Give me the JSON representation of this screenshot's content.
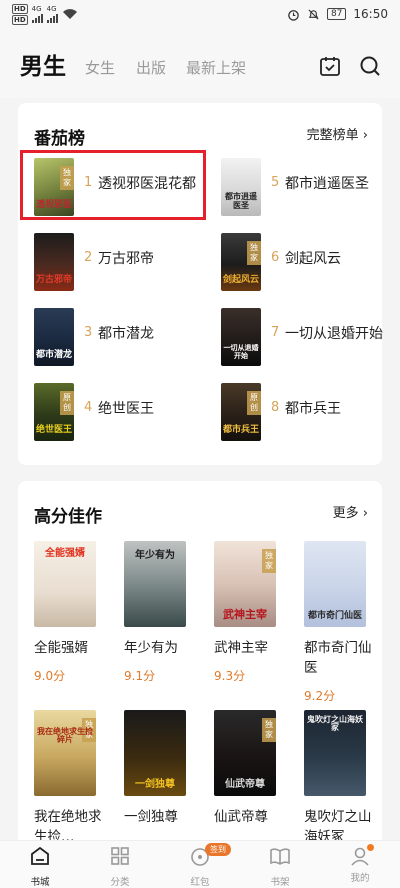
{
  "status_bar": {
    "sim1": "HD",
    "sim2": "HD",
    "network1": "4G",
    "network2": "4G",
    "battery": "87",
    "time": "16:50"
  },
  "header": {
    "tabs": [
      "男生",
      "女生",
      "出版",
      "最新上架"
    ],
    "active_tab": "男生"
  },
  "ranking": {
    "title": "番茄榜",
    "more_label": "完整榜单",
    "items": [
      {
        "rank": "1",
        "title": "透视邪医混花都",
        "cover_text": "透视邪医",
        "badge": "独家"
      },
      {
        "rank": "5",
        "title": "都市逍遥医圣",
        "cover_text": "都市逍遥医圣",
        "badge": ""
      },
      {
        "rank": "2",
        "title": "万古邪帝",
        "cover_text": "万古邪帝",
        "badge": ""
      },
      {
        "rank": "6",
        "title": "剑起风云",
        "cover_text": "剑起风云",
        "badge": "独家"
      },
      {
        "rank": "3",
        "title": "都市潜龙",
        "cover_text": "都市潜龙",
        "badge": ""
      },
      {
        "rank": "7",
        "title": "一切从退婚开始",
        "cover_text": "一切从退婚开始",
        "badge": ""
      },
      {
        "rank": "4",
        "title": "绝世医王",
        "cover_text": "绝世医王",
        "badge": "原创"
      },
      {
        "rank": "8",
        "title": "都市兵王",
        "cover_text": "都市兵王",
        "badge": "原创"
      }
    ]
  },
  "high_score": {
    "title": "高分佳作",
    "more_label": "更多",
    "items": [
      {
        "title": "全能强婿",
        "score": "9.0分",
        "cover_text": "全能强婿",
        "badge": ""
      },
      {
        "title": "年少有为",
        "score": "9.1分",
        "cover_text": "年少有为",
        "badge": ""
      },
      {
        "title": "武神主宰",
        "score": "9.3分",
        "cover_text": "武神主宰",
        "badge": "独家"
      },
      {
        "title": "都市奇门仙医",
        "score": "9.2分",
        "cover_text": "都市奇门仙医",
        "badge": ""
      },
      {
        "title": "我在绝地求生捡…",
        "score": "",
        "cover_text": "我在绝地求生捡碎片",
        "badge": "独家"
      },
      {
        "title": "一剑独尊",
        "score": "",
        "cover_text": "一剑独尊",
        "badge": ""
      },
      {
        "title": "仙武帝尊",
        "score": "",
        "cover_text": "仙武帝尊",
        "badge": "独家"
      },
      {
        "title": "鬼吹灯之山海妖冢",
        "score": "",
        "cover_text": "鬼吹灯之山海妖冢",
        "badge": ""
      }
    ]
  },
  "bottom_nav": {
    "items": [
      "书城",
      "分类",
      "红包",
      "书架",
      "我的"
    ],
    "sign_badge": "签到"
  }
}
